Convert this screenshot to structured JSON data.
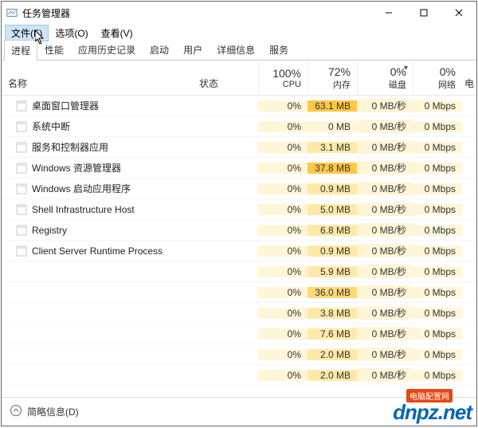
{
  "titlebar": {
    "title": "任务管理器"
  },
  "menubar": {
    "file": "文件(F)",
    "options": "选项(O)",
    "view": "查看(V)"
  },
  "tabs": {
    "process": "进程",
    "performance": "性能",
    "history": "应用历史记录",
    "startup": "启动",
    "users": "用户",
    "details": "详细信息",
    "services": "服务"
  },
  "columns": {
    "name": "名称",
    "status": "状态",
    "cpu_pct": "100%",
    "cpu_label": "CPU",
    "mem_pct": "72%",
    "mem_label": "内存",
    "disk_pct": "0%",
    "disk_label": "磁盘",
    "net_pct": "0%",
    "net_label": "网络",
    "extra": "电"
  },
  "rows": [
    {
      "name": "桌面窗口管理器",
      "cpu": "0%",
      "mem": "63.1 MB",
      "mem_heat": 3,
      "disk": "0 MB/秒",
      "net": "0 Mbps"
    },
    {
      "name": "系统中断",
      "cpu": "0%",
      "mem": "0 MB",
      "mem_heat": 0,
      "disk": "0 MB/秒",
      "net": "0 Mbps"
    },
    {
      "name": "服务和控制器应用",
      "cpu": "0%",
      "mem": "3.1 MB",
      "mem_heat": 1,
      "disk": "0 MB/秒",
      "net": "0 Mbps"
    },
    {
      "name": "Windows 资源管理器",
      "cpu": "0%",
      "mem": "37.8 MB",
      "mem_heat": 3,
      "disk": "0 MB/秒",
      "net": "0 Mbps"
    },
    {
      "name": "Windows 启动应用程序",
      "cpu": "0%",
      "mem": "0.9 MB",
      "mem_heat": 1,
      "disk": "0 MB/秒",
      "net": "0 Mbps"
    },
    {
      "name": "Shell Infrastructure Host",
      "cpu": "0%",
      "mem": "5.0 MB",
      "mem_heat": 1,
      "disk": "0 MB/秒",
      "net": "0 Mbps"
    },
    {
      "name": "Registry",
      "cpu": "0%",
      "mem": "6.8 MB",
      "mem_heat": 1,
      "disk": "0 MB/秒",
      "net": "0 Mbps"
    },
    {
      "name": "Client Server Runtime Process",
      "cpu": "0%",
      "mem": "0.9 MB",
      "mem_heat": 1,
      "disk": "0 MB/秒",
      "net": "0 Mbps"
    },
    {
      "name": "",
      "cpu": "0%",
      "mem": "5.9 MB",
      "mem_heat": 1,
      "disk": "0 MB/秒",
      "net": "0 Mbps"
    },
    {
      "name": "",
      "cpu": "0%",
      "mem": "36.0 MB",
      "mem_heat": 2,
      "disk": "0 MB/秒",
      "net": "0 Mbps"
    },
    {
      "name": "",
      "cpu": "0%",
      "mem": "3.8 MB",
      "mem_heat": 1,
      "disk": "0 MB/秒",
      "net": "0 Mbps"
    },
    {
      "name": "",
      "cpu": "0%",
      "mem": "7.6 MB",
      "mem_heat": 1,
      "disk": "0 MB/秒",
      "net": "0 Mbps"
    },
    {
      "name": "",
      "cpu": "0%",
      "mem": "2.0 MB",
      "mem_heat": 1,
      "disk": "0 MB/秒",
      "net": "0 Mbps"
    },
    {
      "name": "",
      "cpu": "0%",
      "mem": "2.0 MB",
      "mem_heat": 1,
      "disk": "0 MB/秒",
      "net": "0 Mbps"
    }
  ],
  "footer": {
    "fewer_details": "简略信息(D)"
  },
  "watermark": {
    "brand": "dnpz",
    "tld": ".net",
    "badge": "电脑配置网"
  }
}
